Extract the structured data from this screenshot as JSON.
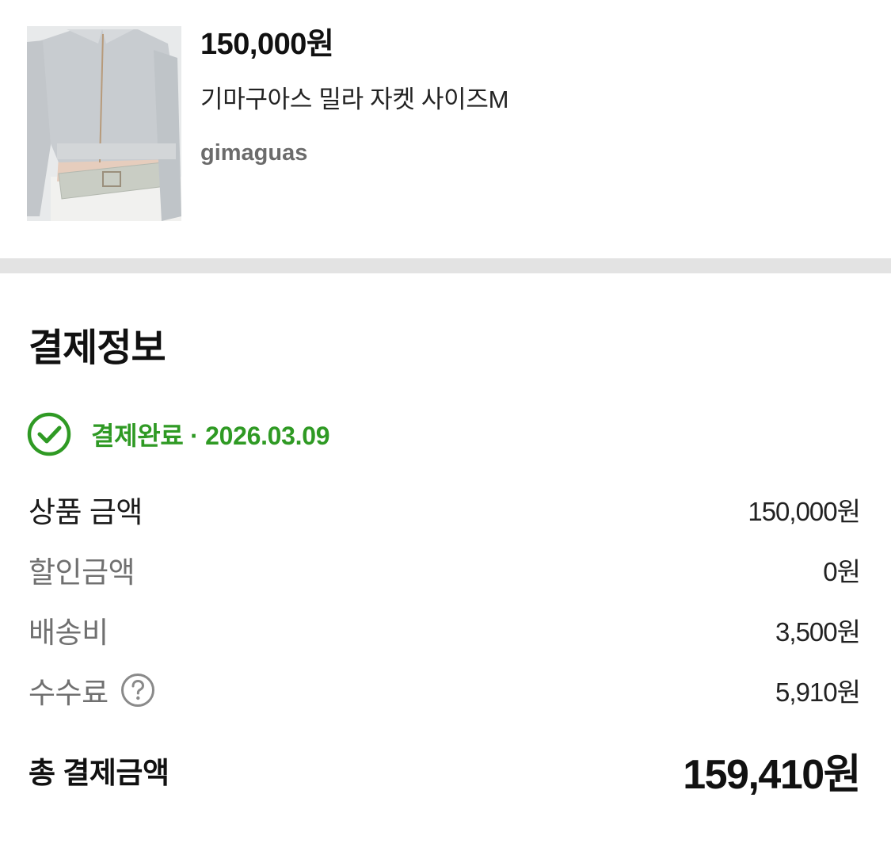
{
  "product": {
    "image_icon": "jacket-photo",
    "price": "150,000원",
    "title": "기마구아스 밀라 자켓 사이즈M",
    "brand": "gimaguas"
  },
  "payment": {
    "section_title": "결제정보",
    "status": {
      "icon": "check-circle-icon",
      "text": "결제완료 · 2026.03.09",
      "color": "#2f9a24"
    },
    "rows": [
      {
        "label": "상품 금액",
        "value": "150,000원"
      },
      {
        "label": "할인금액",
        "value": "0원"
      },
      {
        "label": "배송비",
        "value": "3,500원"
      },
      {
        "label": "수수료",
        "value": "5,910원",
        "help_icon": "question-circle-icon"
      }
    ],
    "total": {
      "label": "총 결제금액",
      "value": "159,410원"
    }
  },
  "colors": {
    "divider": "#e3e3e3",
    "success_green": "#2f9a24",
    "muted_label": "#707070"
  }
}
